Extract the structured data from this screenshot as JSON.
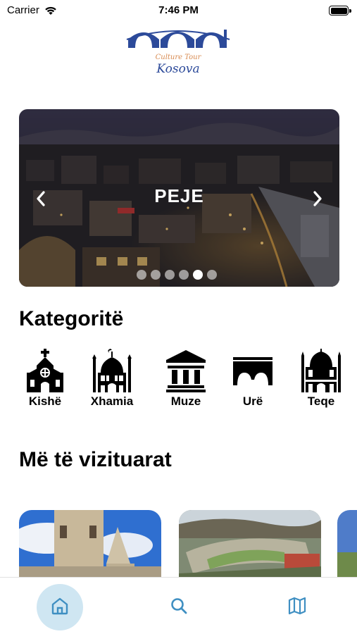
{
  "status_bar": {
    "carrier": "Carrier",
    "time": "7:46 PM"
  },
  "logo": {
    "subtitle": "Culture Tour",
    "title": "Kosova"
  },
  "carousel": {
    "title": "PEJE",
    "slide_count": 6,
    "active_index": 4
  },
  "categories": {
    "title": "Kategoritë",
    "items": [
      {
        "label": "Kishë",
        "icon": "church-icon"
      },
      {
        "label": "Xhamia",
        "icon": "mosque-icon"
      },
      {
        "label": "Muze",
        "icon": "museum-icon"
      },
      {
        "label": "Urë",
        "icon": "bridge-icon"
      },
      {
        "label": "Teqe",
        "icon": "tekke-icon"
      }
    ]
  },
  "popular": {
    "title": "Më të vizituarat"
  },
  "tab_bar": {
    "items": [
      "home-icon",
      "search-icon",
      "map-icon"
    ],
    "active": "home-icon"
  },
  "colors": {
    "tab_active_bg": "#cfe6f2",
    "tab_icon": "#3f8fc2",
    "logo_blue": "#2c4a9a",
    "logo_orange": "#d88a50"
  }
}
